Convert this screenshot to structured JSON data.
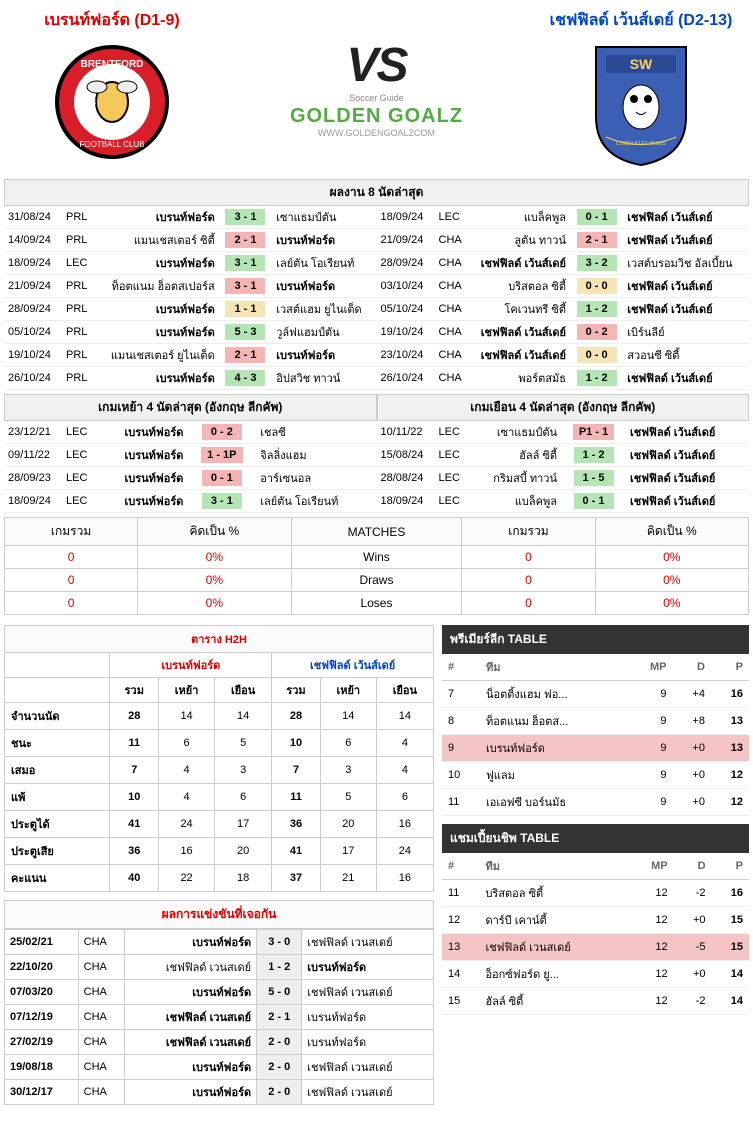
{
  "header": {
    "home_name": "เบรนท์ฟอร์ด (D1-9)",
    "away_name": "เชฟฟิลด์ เว้นส์เดย์ (D2-13)",
    "vs_label": "VS",
    "brand": "GOLDEN GOALZ",
    "brand_sub": "WWW.GOLDENGOALZCOM",
    "brand_tag": "Soccer Guide"
  },
  "last8_title": "ผลงาน 8 นัดล่าสุด",
  "last8_home": [
    {
      "d": "31/08/24",
      "c": "PRL",
      "h": "เบรนท์ฟอร์ด",
      "hb": true,
      "s": "3 - 1",
      "r": "w",
      "a": "เซาแธมป์ตัน"
    },
    {
      "d": "14/09/24",
      "c": "PRL",
      "h": "แมนเชสเตอร์ ซิตี้",
      "s": "2 - 1",
      "r": "l",
      "a": "เบรนท์ฟอร์ด",
      "ab": true
    },
    {
      "d": "18/09/24",
      "c": "LEC",
      "h": "เบรนท์ฟอร์ด",
      "hb": true,
      "s": "3 - 1",
      "r": "w",
      "a": "เลย์ตัน โอเรียนท์"
    },
    {
      "d": "21/09/24",
      "c": "PRL",
      "h": "ท็อตแนม ฮ็อตสเปอร์ส",
      "s": "3 - 1",
      "r": "l",
      "a": "เบรนท์ฟอร์ด",
      "ab": true
    },
    {
      "d": "28/09/24",
      "c": "PRL",
      "h": "เบรนท์ฟอร์ด",
      "hb": true,
      "s": "1 - 1",
      "r": "d",
      "a": "เวสต์แฮม ยูไนเต็ด"
    },
    {
      "d": "05/10/24",
      "c": "PRL",
      "h": "เบรนท์ฟอร์ด",
      "hb": true,
      "s": "5 - 3",
      "r": "w",
      "a": "วูล์ฟแฮมป์ตัน"
    },
    {
      "d": "19/10/24",
      "c": "PRL",
      "h": "แมนเชสเตอร์ ยูไนเต็ด",
      "s": "2 - 1",
      "r": "l",
      "a": "เบรนท์ฟอร์ด",
      "ab": true
    },
    {
      "d": "26/10/24",
      "c": "PRL",
      "h": "เบรนท์ฟอร์ด",
      "hb": true,
      "s": "4 - 3",
      "r": "w",
      "a": "อิปสวิช ทาวน์"
    }
  ],
  "last8_away": [
    {
      "d": "18/09/24",
      "c": "LEC",
      "h": "แบล็คพูล",
      "s": "0 - 1",
      "r": "w",
      "a": "เชฟฟิลด์ เว้นส์เดย์",
      "ab": true
    },
    {
      "d": "21/09/24",
      "c": "CHA",
      "h": "ลูตัน ทาวน์",
      "s": "2 - 1",
      "r": "l",
      "a": "เชฟฟิลด์ เว้นส์เดย์",
      "ab": true
    },
    {
      "d": "28/09/24",
      "c": "CHA",
      "h": "เชฟฟิลด์ เว้นส์เดย์",
      "hb": true,
      "s": "3 - 2",
      "r": "w",
      "a": "เวสต์บรอมวิช อัลเบี้ยน"
    },
    {
      "d": "03/10/24",
      "c": "CHA",
      "h": "บริสตอล ซิตี้",
      "s": "0 - 0",
      "r": "d",
      "a": "เชฟฟิลด์ เว้นส์เดย์",
      "ab": true
    },
    {
      "d": "05/10/24",
      "c": "CHA",
      "h": "โคเวนทรี ซิตี้",
      "s": "1 - 2",
      "r": "w",
      "a": "เชฟฟิลด์ เว้นส์เดย์",
      "ab": true
    },
    {
      "d": "19/10/24",
      "c": "CHA",
      "h": "เชฟฟิลด์ เว้นส์เดย์",
      "hb": true,
      "s": "0 - 2",
      "r": "l",
      "a": "เบิร์นลีย์"
    },
    {
      "d": "23/10/24",
      "c": "CHA",
      "h": "เชฟฟิลด์ เว้นส์เดย์",
      "hb": true,
      "s": "0 - 0",
      "r": "d",
      "a": "สวอนซี ซิตี้"
    },
    {
      "d": "26/10/24",
      "c": "CHA",
      "h": "พอร์ตสมัธ",
      "s": "1 - 2",
      "r": "w",
      "a": "เชฟฟิลด์ เว้นส์เดย์",
      "ab": true
    }
  ],
  "cup_home_title": "เกมเหย้า 4 นัดล่าสุด (อังกฤษ ลีกคัพ)",
  "cup_away_title": "เกมเยือน 4 นัดล่าสุด (อังกฤษ ลีกคัพ)",
  "cup_home": [
    {
      "d": "23/12/21",
      "c": "LEC",
      "h": "เบรนท์ฟอร์ด",
      "hb": true,
      "s": "0 - 2",
      "r": "l",
      "a": "เชลซี"
    },
    {
      "d": "09/11/22",
      "c": "LEC",
      "h": "เบรนท์ฟอร์ด",
      "hb": true,
      "s": "1 - 1P",
      "r": "l",
      "a": "จิลลิ่งแฮม"
    },
    {
      "d": "28/09/23",
      "c": "LEC",
      "h": "เบรนท์ฟอร์ด",
      "hb": true,
      "s": "0 - 1",
      "r": "l",
      "a": "อาร์เซนอล"
    },
    {
      "d": "18/09/24",
      "c": "LEC",
      "h": "เบรนท์ฟอร์ด",
      "hb": true,
      "s": "3 - 1",
      "r": "w",
      "a": "เลย์ตัน โอเรียนท์"
    }
  ],
  "cup_away": [
    {
      "d": "10/11/22",
      "c": "LEC",
      "h": "เซาแธมป์ตัน",
      "s": "P1 - 1",
      "r": "l",
      "a": "เชฟฟิลด์ เว้นส์เดย์",
      "ab": true
    },
    {
      "d": "15/08/24",
      "c": "LEC",
      "h": "ฮัลล์ ซิตี้",
      "s": "1 - 2",
      "r": "w",
      "a": "เชฟฟิลด์ เว้นส์เดย์",
      "ab": true
    },
    {
      "d": "28/08/24",
      "c": "LEC",
      "h": "กริมสบี้ ทาวน์",
      "s": "1 - 5",
      "r": "w",
      "a": "เชฟฟิลด์ เว้นส์เดย์",
      "ab": true
    },
    {
      "d": "18/09/24",
      "c": "LEC",
      "h": "แบล็คพูล",
      "s": "0 - 1",
      "r": "w",
      "a": "เชฟฟิลด์ เว้นส์เดย์",
      "ab": true
    }
  ],
  "wdl_headers": {
    "total": "เกมรวม",
    "pct": "คิดเป็น %",
    "mid": "MATCHES"
  },
  "wdl_rows": [
    {
      "ht": "0",
      "hp": "0%",
      "lbl": "Wins",
      "at": "0",
      "ap": "0%"
    },
    {
      "ht": "0",
      "hp": "0%",
      "lbl": "Draws",
      "at": "0",
      "ap": "0%"
    },
    {
      "ht": "0",
      "hp": "0%",
      "lbl": "Loses",
      "at": "0",
      "ap": "0%"
    }
  ],
  "h2h": {
    "title": "ตาราง H2H",
    "home_name": "เบรนท์ฟอร์ด",
    "away_name": "เชฟฟิลด์ เว้นส์เดย์",
    "cols": [
      "รวม",
      "เหย้า",
      "เยือน",
      "รวม",
      "เหย้า",
      "เยือน"
    ],
    "rows": [
      {
        "lbl": "จำนวนนัด",
        "v": [
          "28",
          "14",
          "14",
          "28",
          "14",
          "14"
        ]
      },
      {
        "lbl": "ชนะ",
        "v": [
          "11",
          "6",
          "5",
          "10",
          "6",
          "4"
        ]
      },
      {
        "lbl": "เสมอ",
        "v": [
          "7",
          "4",
          "3",
          "7",
          "3",
          "4"
        ]
      },
      {
        "lbl": "แพ้",
        "v": [
          "10",
          "4",
          "6",
          "11",
          "5",
          "6"
        ]
      },
      {
        "lbl": "ประตูได้",
        "v": [
          "41",
          "24",
          "17",
          "36",
          "20",
          "16"
        ]
      },
      {
        "lbl": "ประตูเสีย",
        "v": [
          "36",
          "16",
          "20",
          "41",
          "17",
          "24"
        ]
      },
      {
        "lbl": "คะแนน",
        "v": [
          "40",
          "22",
          "18",
          "37",
          "21",
          "16"
        ]
      }
    ]
  },
  "meetings": {
    "title": "ผลการแข่งขันที่เจอกัน",
    "rows": [
      {
        "d": "25/02/21",
        "c": "CHA",
        "h": "เบรนท์ฟอร์ด",
        "hb": true,
        "s": "3 - 0",
        "a": "เชฟฟิลด์ เวนสเดย์"
      },
      {
        "d": "22/10/20",
        "c": "CHA",
        "h": "เชฟฟิลด์ เวนสเดย์",
        "s": "1 - 2",
        "a": "เบรนท์ฟอร์ด",
        "ab": true
      },
      {
        "d": "07/03/20",
        "c": "CHA",
        "h": "เบรนท์ฟอร์ด",
        "hb": true,
        "s": "5 - 0",
        "a": "เชฟฟิลด์ เวนสเดย์"
      },
      {
        "d": "07/12/19",
        "c": "CHA",
        "h": "เชฟฟิลด์ เวนสเดย์",
        "hb": true,
        "s": "2 - 1",
        "a": "เบรนท์ฟอร์ด"
      },
      {
        "d": "27/02/19",
        "c": "CHA",
        "h": "เชฟฟิลด์ เวนสเดย์",
        "hb": true,
        "s": "2 - 0",
        "a": "เบรนท์ฟอร์ด"
      },
      {
        "d": "19/08/18",
        "c": "CHA",
        "h": "เบรนท์ฟอร์ด",
        "hb": true,
        "s": "2 - 0",
        "a": "เชฟฟิลด์ เวนสเดย์"
      },
      {
        "d": "30/12/17",
        "c": "CHA",
        "h": "เบรนท์ฟอร์ด",
        "hb": true,
        "s": "2 - 0",
        "a": "เชฟฟิลด์ เวนสเดย์"
      }
    ]
  },
  "standings": [
    {
      "title": "พรีเมียร์ลีก TABLE",
      "cols": {
        "pos": "#",
        "team": "ทีม",
        "mp": "MP",
        "d": "D",
        "p": "P"
      },
      "rows": [
        {
          "pos": "7",
          "team": "น็อตติ้งแฮม ฟอ...",
          "mp": "9",
          "d": "+4",
          "p": "16"
        },
        {
          "pos": "8",
          "team": "ท็อตแนม ฮ็อตส...",
          "mp": "9",
          "d": "+8",
          "p": "13"
        },
        {
          "pos": "9",
          "team": "เบรนท์ฟอร์ด",
          "mp": "9",
          "d": "+0",
          "p": "13",
          "hl": true
        },
        {
          "pos": "10",
          "team": "ฟูแลม",
          "mp": "9",
          "d": "+0",
          "p": "12"
        },
        {
          "pos": "11",
          "team": "เอเอฟซี บอร์นมัธ",
          "mp": "9",
          "d": "+0",
          "p": "12"
        }
      ]
    },
    {
      "title": "แชมเปี้ยนชิพ TABLE",
      "cols": {
        "pos": "#",
        "team": "ทีม",
        "mp": "MP",
        "d": "D",
        "p": "P"
      },
      "rows": [
        {
          "pos": "11",
          "team": "บริสตอล ซิตี้",
          "mp": "12",
          "d": "-2",
          "p": "16"
        },
        {
          "pos": "12",
          "team": "ดาร์บี เคาน์ตี้",
          "mp": "12",
          "d": "+0",
          "p": "15"
        },
        {
          "pos": "13",
          "team": "เชฟฟิลด์ เวนสเดย์",
          "mp": "12",
          "d": "-5",
          "p": "15",
          "hl": true
        },
        {
          "pos": "14",
          "team": "อ็อกซ์ฟอร์ด ยู...",
          "mp": "12",
          "d": "+0",
          "p": "14"
        },
        {
          "pos": "15",
          "team": "ฮัลล์ ซิตี้",
          "mp": "12",
          "d": "-2",
          "p": "14"
        }
      ]
    }
  ]
}
